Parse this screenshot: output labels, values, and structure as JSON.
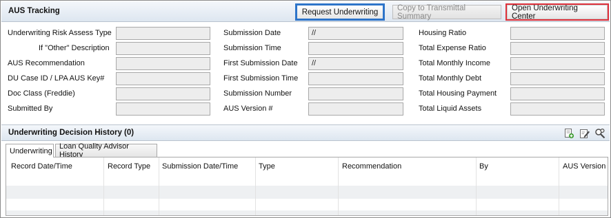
{
  "aus_tracking": {
    "title": "AUS Tracking",
    "buttons": {
      "request_underwriting": "Request Underwriting",
      "copy_to_transmittal": "Copy to Transmittal Summary",
      "open_underwriting_center": "Open Underwriting Center"
    },
    "left_fields": [
      {
        "label": "Underwriting Risk Assess Type",
        "value": ""
      },
      {
        "label": "If \"Other\" Description",
        "value": ""
      },
      {
        "label": "AUS Recommendation",
        "value": ""
      },
      {
        "label": "DU Case ID / LPA AUS Key#",
        "value": ""
      },
      {
        "label": "Doc Class (Freddie)",
        "value": ""
      },
      {
        "label": "Submitted By",
        "value": ""
      }
    ],
    "mid_fields": [
      {
        "label": "Submission Date",
        "value": "//"
      },
      {
        "label": "Submission Time",
        "value": ""
      },
      {
        "label": "First Submission Date",
        "value": "//"
      },
      {
        "label": "First Submission Time",
        "value": ""
      },
      {
        "label": "Submission Number",
        "value": ""
      },
      {
        "label": "AUS Version #",
        "value": ""
      }
    ],
    "right_fields": [
      {
        "label": "Housing Ratio",
        "value": ""
      },
      {
        "label": "Total Expense Ratio",
        "value": ""
      },
      {
        "label": "Total Monthly Income",
        "value": ""
      },
      {
        "label": "Total Monthly Debt",
        "value": ""
      },
      {
        "label": "Total Housing Payment",
        "value": ""
      },
      {
        "label": "Total Liquid Assets",
        "value": ""
      }
    ]
  },
  "decision_history": {
    "title": "Underwriting Decision History (0)",
    "icons": [
      "add-record-icon",
      "edit-record-icon",
      "search-record-icon"
    ],
    "tabs": [
      "Underwriting",
      "Loan Quality Advisor History"
    ],
    "active_tab": "Underwriting",
    "columns": [
      "Record Date/Time",
      "Record Type",
      "Submission Date/Time",
      "Type",
      "Recommendation",
      "By",
      "AUS Version"
    ],
    "rows": []
  }
}
